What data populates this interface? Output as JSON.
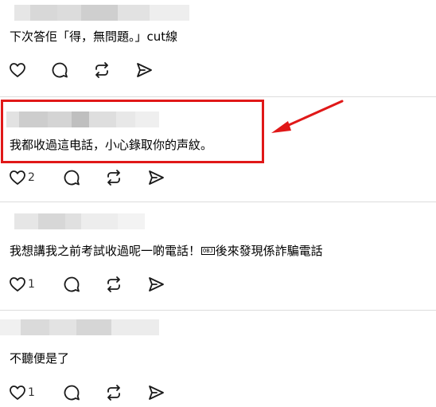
{
  "comments": [
    {
      "text": "下次答佢「得，無問題。」cut線",
      "likes": "",
      "actions": {
        "like": "heart-icon",
        "reply": "comment-icon",
        "repost": "repost-icon",
        "share": "send-icon"
      }
    },
    {
      "text": "我都收過這电話，小心錄取你的声紋。",
      "likes": "2",
      "highlighted": true
    },
    {
      "text_before": "我想講我之前考試收過呢一啲電話！",
      "ctrl_char": "OBJ",
      "text_after": "後來發現係詐騙電話",
      "likes": "1"
    },
    {
      "text": "不聽便是了",
      "likes": "1"
    }
  ],
  "colors": {
    "highlight": "#e01818",
    "divider": "#dcdcdc",
    "icon": "#1a1a1a",
    "blur_tones": [
      "#c8c8c8",
      "#d6d6d6",
      "#e0e0e0",
      "#ececec",
      "#f2f2f2"
    ]
  }
}
